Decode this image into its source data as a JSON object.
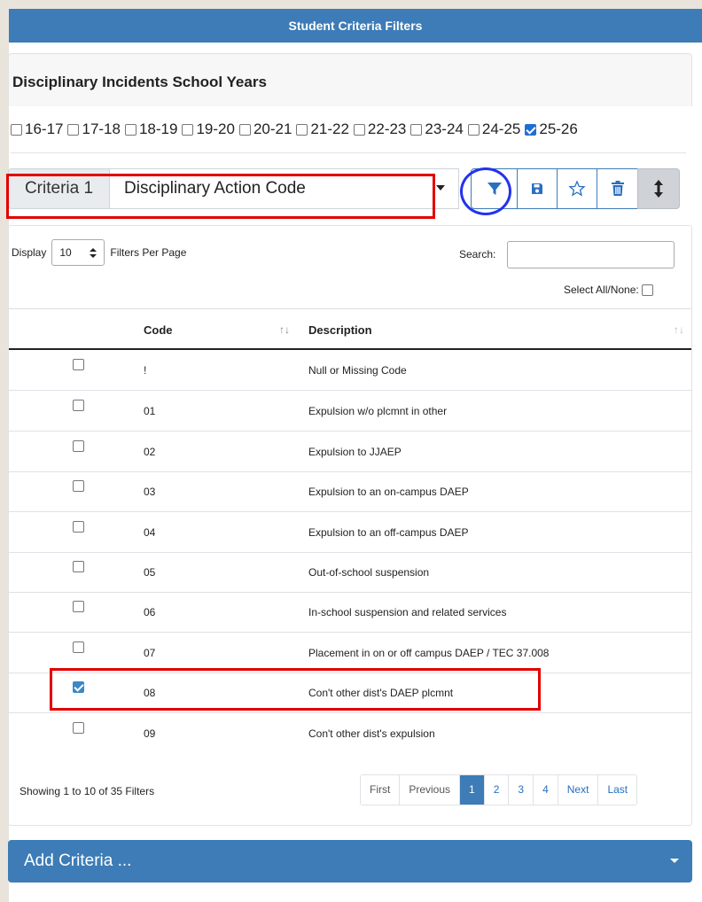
{
  "header": {
    "title": "Student Criteria Filters"
  },
  "section": {
    "title": "Disciplinary Incidents School Years"
  },
  "years": [
    {
      "label": "16-17",
      "checked": false
    },
    {
      "label": "17-18",
      "checked": false
    },
    {
      "label": "18-19",
      "checked": false
    },
    {
      "label": "19-20",
      "checked": false
    },
    {
      "label": "20-21",
      "checked": false
    },
    {
      "label": "21-22",
      "checked": false
    },
    {
      "label": "22-23",
      "checked": false
    },
    {
      "label": "23-24",
      "checked": false
    },
    {
      "label": "24-25",
      "checked": false
    },
    {
      "label": "25-26",
      "checked": true
    }
  ],
  "criteria": {
    "label": "Criteria 1",
    "selected": "Disciplinary Action Code"
  },
  "toolbar": {
    "icons": [
      "filter-icon",
      "save-icon",
      "star-icon",
      "trash-icon",
      "resize-vertical-icon"
    ]
  },
  "table_controls": {
    "display_label": "Display",
    "display_value": "10",
    "per_page_label": "Filters Per Page",
    "search_label": "Search:",
    "search_value": "",
    "select_all_label": "Select All/None:"
  },
  "table": {
    "columns": [
      "Code",
      "Description"
    ],
    "rows": [
      {
        "code": "!",
        "description": "Null or Missing Code",
        "checked": false
      },
      {
        "code": "01",
        "description": "Expulsion w/o plcmnt in other",
        "checked": false
      },
      {
        "code": "02",
        "description": "Expulsion to JJAEP",
        "checked": false
      },
      {
        "code": "03",
        "description": "Expulsion to an on-campus DAEP",
        "checked": false
      },
      {
        "code": "04",
        "description": "Expulsion to an off-campus DAEP",
        "checked": false
      },
      {
        "code": "05",
        "description": "Out-of-school suspension",
        "checked": false
      },
      {
        "code": "06",
        "description": "In-school suspension and related services",
        "checked": false
      },
      {
        "code": "07",
        "description": "Placement in on or off campus DAEP / TEC 37.008",
        "checked": false
      },
      {
        "code": "08",
        "description": "Con't other dist's DAEP plcmnt",
        "checked": true
      },
      {
        "code": "09",
        "description": "Con't other dist's expulsion",
        "checked": false
      }
    ]
  },
  "footer": {
    "showing": "Showing 1 to 10 of 35 Filters"
  },
  "pagination": [
    {
      "label": "First",
      "active": false
    },
    {
      "label": "Previous",
      "active": false
    },
    {
      "label": "1",
      "active": true
    },
    {
      "label": "2",
      "active": false
    },
    {
      "label": "3",
      "active": false
    },
    {
      "label": "4",
      "active": false
    },
    {
      "label": "Next",
      "active": false
    },
    {
      "label": "Last",
      "active": false
    }
  ],
  "add_criteria": {
    "label": "Add Criteria ..."
  },
  "colors": {
    "primary": "#3d7cb6",
    "highlight_red": "#e00000",
    "highlight_blue": "#2233ee"
  }
}
